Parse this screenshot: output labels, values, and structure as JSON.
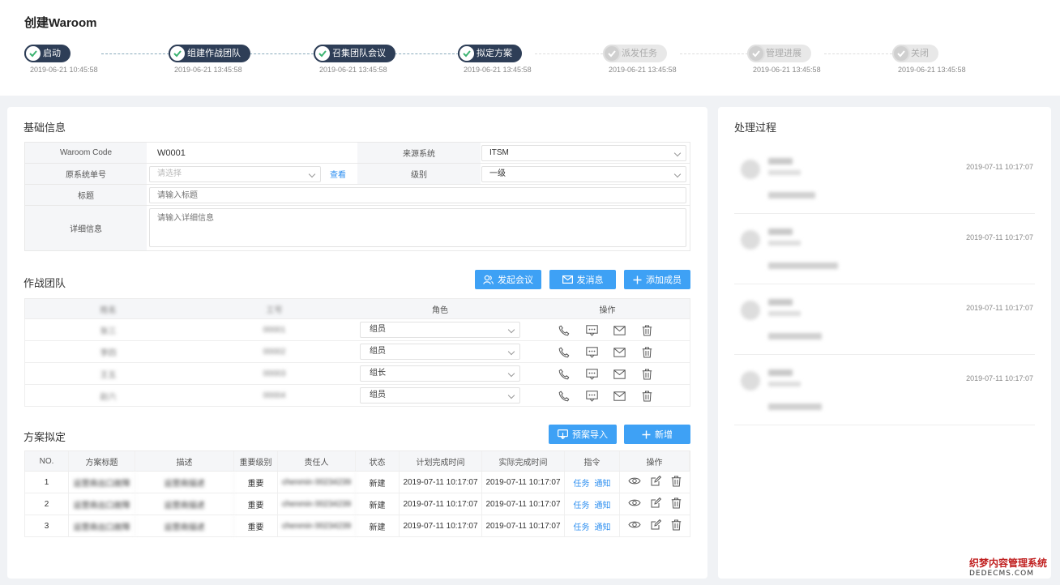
{
  "page": {
    "title": "创建Waroom"
  },
  "steps": [
    {
      "label": "启动",
      "time": "2019-06-21 10:45:58",
      "done": true
    },
    {
      "label": "组建作战团队",
      "time": "2019-06-21 13:45:58",
      "done": true
    },
    {
      "label": "召集团队会议",
      "time": "2019-06-21 13:45:58",
      "done": true
    },
    {
      "label": "拟定方案",
      "time": "2019-06-21 13:45:58",
      "done": true
    },
    {
      "label": "派发任务",
      "time": "2019-06-21 13:45:58",
      "done": false
    },
    {
      "label": "管理进展",
      "time": "2019-06-21 13:45:58",
      "done": false
    },
    {
      "label": "关闭",
      "time": "2019-06-21 13:45:58",
      "done": false
    }
  ],
  "basic_info": {
    "title": "基础信息",
    "waroom_code_label": "Waroom  Code",
    "waroom_code_value": "W0001",
    "source_system_label": "来源系统",
    "source_system_value": "ITSM",
    "original_ticket_label": "原系统单号",
    "original_ticket_placeholder": "请选择",
    "view_link": "查看",
    "level_label": "级别",
    "level_value": "一级",
    "subject_label": "标题",
    "subject_placeholder": "请输入标题",
    "detail_label": "详细信息",
    "detail_placeholder": "请输入详细信息"
  },
  "team": {
    "title": "作战团队",
    "buttons": {
      "meeting": "发起会议",
      "message": "发消息",
      "add_member": "添加成员"
    },
    "columns": {
      "name": "姓名",
      "phone": "工号",
      "role": "角色",
      "ops": "操作"
    },
    "rows": [
      {
        "name": "张三",
        "phone": "00001",
        "role": "组员"
      },
      {
        "name": "李四",
        "phone": "00002",
        "role": "组员"
      },
      {
        "name": "王五",
        "phone": "00003",
        "role": "组长"
      },
      {
        "name": "赵六",
        "phone": "00004",
        "role": "组员"
      }
    ]
  },
  "plan": {
    "title": "方案拟定",
    "buttons": {
      "import": "预案导入",
      "add": "新增"
    },
    "columns": [
      "NO.",
      "方案标题",
      "描述",
      "重要级别",
      "责任人",
      "状态",
      "计划完成时间",
      "实际完成时间",
      "指令",
      "操作"
    ],
    "rows": [
      {
        "no": "1",
        "title": "运营商出口故障",
        "desc": "运营商描述",
        "level": "重要",
        "owner": "chenmin 00234239",
        "status": "新建",
        "planned": "2019-07-11 10:17:07",
        "actual": "2019-07-11 10:17:07",
        "task": "任务",
        "notify": "通知"
      },
      {
        "no": "2",
        "title": "运营商出口故障",
        "desc": "运营商描述",
        "level": "重要",
        "owner": "chenmin 00234239",
        "status": "新建",
        "planned": "2019-07-11 10:17:07",
        "actual": "2019-07-11 10:17:07",
        "task": "任务",
        "notify": "通知"
      },
      {
        "no": "3",
        "title": "运营商出口故障",
        "desc": "运营商描述",
        "level": "重要",
        "owner": "chenmin 00234239",
        "status": "新建",
        "planned": "2019-07-11 10:17:07",
        "actual": "2019-07-11 10:17:07",
        "task": "任务",
        "notify": "通知"
      }
    ]
  },
  "process": {
    "title": "处理过程",
    "items": [
      {
        "time": "2019-07-11 10:17:07"
      },
      {
        "time": "2019-07-11 10:17:07"
      },
      {
        "time": "2019-07-11 10:17:07"
      },
      {
        "time": "2019-07-11 10:17:07"
      }
    ]
  },
  "watermark": {
    "cn": "织梦内容管理系统",
    "en": "DEDECMS.COM"
  },
  "colors": {
    "accent": "#3ea1f5",
    "step_done": "#2e3e57",
    "link": "#2b8ef0"
  }
}
